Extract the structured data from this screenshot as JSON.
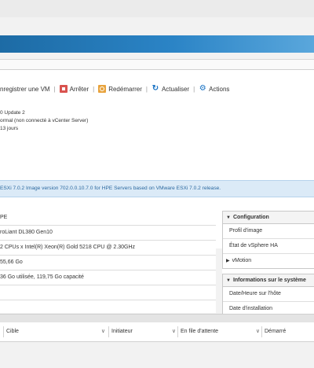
{
  "toolbar": {
    "register_label": "nregistrer une VM",
    "shutdown_label": "Arrêter",
    "reboot_label": "Redémarrer",
    "refresh_label": "Actualiser",
    "actions_label": "Actions"
  },
  "host_info": {
    "version": "0 Update 2",
    "state": "ormal (non connecté à vCenter Server)",
    "uptime": "13 jours"
  },
  "notice": {
    "text": "ESXi 7.0.2 Image version 702.0.0.10.7.0 for HPE Servers based on VMware ESXi 7.0.2 release."
  },
  "hardware": {
    "rows": [
      "PE",
      "roLiant DL380 Gen10",
      "2 CPUs x Intel(R) Xeon(R) Gold 5218 CPU @ 2.30GHz",
      "55,66 Go",
      "36 Go utilisée, 119,75 Go capacité",
      ""
    ]
  },
  "configuration": {
    "title": "Configuration",
    "items": [
      "Profil d'image",
      "État de vSphere HA",
      "vMotion"
    ]
  },
  "system_info": {
    "title": "Informations sur le système",
    "items": [
      "Date/Heure sur l'hôte",
      "Date d'installation"
    ]
  },
  "tasks": {
    "columns": [
      "Cible",
      "Initiateur",
      "En file d'attente",
      "Démarré"
    ]
  },
  "colors": {
    "banner": "#2b84c6",
    "notice_bg": "#dbeaf7",
    "notice_text": "#2d6aa0",
    "shutdown_icon": "#d9534f",
    "reboot_icon": "#e8a33d",
    "accent_icon": "#1a73c4"
  },
  "icons": [
    "shutdown-icon",
    "reboot-icon",
    "refresh-icon",
    "gear-icon",
    "chevron-down-icon",
    "chevron-right-icon"
  ]
}
